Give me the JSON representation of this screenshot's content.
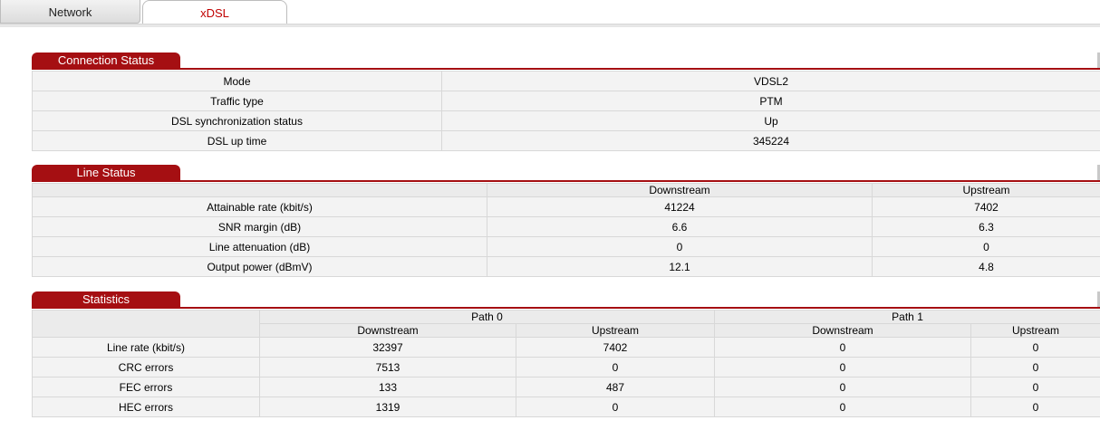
{
  "tabs": [
    {
      "label": "Network"
    },
    {
      "label": "xDSL"
    }
  ],
  "connection_status": {
    "title": "Connection Status",
    "rows": [
      {
        "label": "Mode",
        "value": "VDSL2"
      },
      {
        "label": "Traffic type",
        "value": "PTM"
      },
      {
        "label": "DSL synchronization status",
        "value": "Up"
      },
      {
        "label": "DSL up time",
        "value": "345224"
      }
    ]
  },
  "line_status": {
    "title": "Line Status",
    "headers": {
      "downstream": "Downstream",
      "upstream": "Upstream"
    },
    "rows": [
      {
        "label": "Attainable rate (kbit/s)",
        "down": "41224",
        "up": "7402"
      },
      {
        "label": "SNR margin (dB)",
        "down": "6.6",
        "up": "6.3"
      },
      {
        "label": "Line attenuation (dB)",
        "down": "0",
        "up": "0"
      },
      {
        "label": "Output power (dBmV)",
        "down": "12.1",
        "up": "4.8"
      }
    ]
  },
  "statistics": {
    "title": "Statistics",
    "paths": [
      "Path 0",
      "Path 1"
    ],
    "headers": {
      "downstream": "Downstream",
      "upstream": "Upstream"
    },
    "rows": [
      {
        "label": "Line rate (kbit/s)",
        "p0_down": "32397",
        "p0_up": "7402",
        "p1_down": "0",
        "p1_up": "0"
      },
      {
        "label": "CRC errors",
        "p0_down": "7513",
        "p0_up": "0",
        "p1_down": "0",
        "p1_up": "0"
      },
      {
        "label": "FEC errors",
        "p0_down": "133",
        "p0_up": "487",
        "p1_down": "0",
        "p1_up": "0"
      },
      {
        "label": "HEC errors",
        "p0_down": "1319",
        "p0_up": "0",
        "p1_down": "0",
        "p1_up": "0"
      }
    ]
  }
}
